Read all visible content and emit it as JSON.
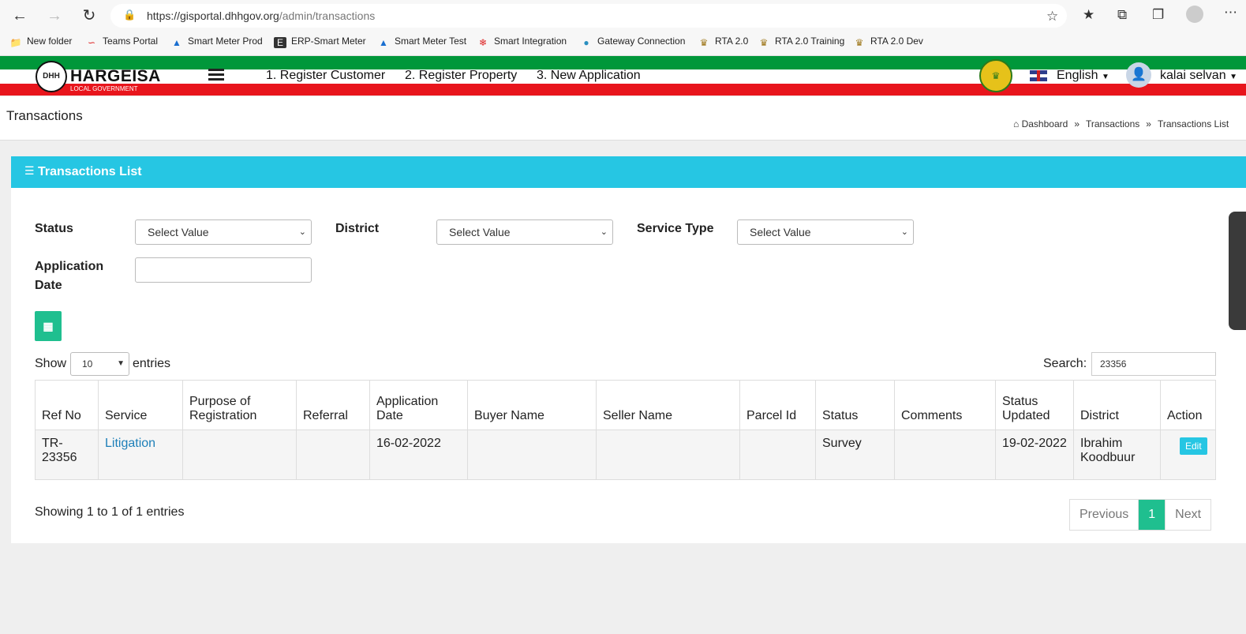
{
  "browser": {
    "url_host": "https://gisportal.dhhgov.org",
    "url_path": "/admin/transactions",
    "bookmarks": [
      "New folder",
      "Teams Portal",
      "Smart Meter Prod",
      "ERP-Smart Meter",
      "Smart Meter Test",
      "Smart Integration",
      "Gateway Connection",
      "RTA 2.0",
      "RTA 2.0 Training",
      "RTA 2.0 Dev"
    ]
  },
  "header": {
    "logo_title": "HARGEISA",
    "logo_subtitle": "LOCAL GOVERNMENT",
    "logo_mark": "DHH",
    "nav": [
      "1. Register Customer",
      "2. Register Property",
      "3. New Application"
    ],
    "language": "English",
    "user_name": "kalai selvan"
  },
  "page": {
    "title": "Transactions",
    "breadcrumb": [
      "Dashboard",
      "Transactions",
      "Transactions List"
    ]
  },
  "card": {
    "title": "Transactions List",
    "filters": {
      "status_label": "Status",
      "status_value": "Select Value",
      "district_label": "District",
      "district_value": "Select Value",
      "service_type_label": "Service Type",
      "service_type_value": "Select Value",
      "app_date_label_1": "Application",
      "app_date_label_2": "Date"
    },
    "show_label": "Show",
    "entries_label": "entries",
    "page_length": "10",
    "search_label": "Search:",
    "search_value": "23356",
    "columns": [
      "Ref No",
      "Service",
      "Purpose of Registration",
      "Referral",
      "Application Date",
      "Buyer Name",
      "Seller Name",
      "Parcel Id",
      "Status",
      "Comments",
      "Status Updated",
      "District",
      "Action"
    ],
    "rows": [
      {
        "ref_no": "TR-23356",
        "service": "Litigation",
        "purpose": "",
        "referral": "",
        "application_date": "16-02-2022",
        "buyer": "",
        "seller": "",
        "parcel_id": "",
        "status": "Survey",
        "comments": "",
        "status_updated": "19-02-2022",
        "district": "Ibrahim Koodbuur",
        "action": "Edit"
      }
    ],
    "info": "Showing 1 to 1 of 1 entries",
    "pagination": {
      "previous": "Previous",
      "current": "1",
      "next": "Next"
    }
  },
  "colors": {
    "accent": "#26c6e3",
    "success": "#1fbf8f",
    "flag_green": "#00973a",
    "flag_red": "#e8151c"
  }
}
